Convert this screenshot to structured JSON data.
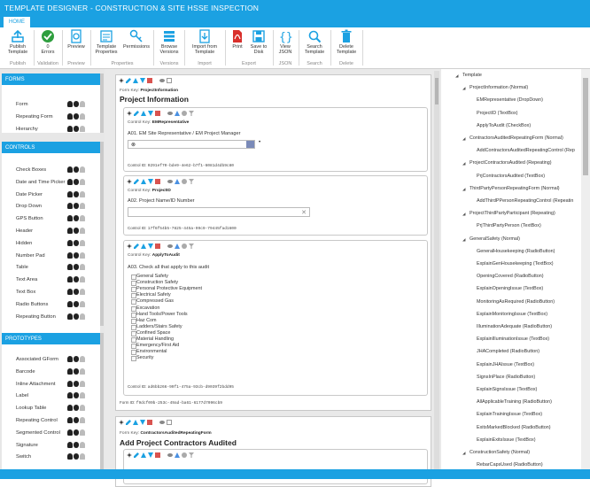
{
  "app": {
    "title": "TEMPLATE DESIGNER - CONSTRUCTION & SITE HSSE INSPECTION",
    "tab": "HOME"
  },
  "ribbon": {
    "buttons": [
      {
        "label": "Publish\nTemplate",
        "icon": "upload-icon"
      },
      {
        "label": "0\nErrors",
        "icon": "check-circle-icon"
      },
      {
        "label": "Preview",
        "icon": "preview-icon"
      },
      {
        "label": "Template\nProperties",
        "icon": "properties-icon"
      },
      {
        "label": "Permissions",
        "icon": "key-icon"
      },
      {
        "label": "Browse\nVersions",
        "icon": "versions-icon"
      },
      {
        "label": "Import from\nTemplate",
        "icon": "import-icon"
      },
      {
        "label": "Print",
        "icon": "pdf-icon"
      },
      {
        "label": "Save to\nDisk",
        "icon": "save-icon"
      },
      {
        "label": "View\nJSON",
        "icon": "json-icon"
      },
      {
        "label": "Search\nTemplate",
        "icon": "search-icon"
      },
      {
        "label": "Delete\nTemplate",
        "icon": "trash-icon"
      }
    ],
    "groups": [
      "Publish",
      "Validation",
      "Preview",
      "Properties",
      "Versions",
      "Import",
      "Export",
      "JSON",
      "Search",
      "Delete"
    ]
  },
  "left": {
    "forms": {
      "title": "FORMS",
      "items": [
        "Form",
        "Repeating Form",
        "Hierarchy"
      ]
    },
    "controls": {
      "title": "CONTROLS",
      "items": [
        "Check Boxes",
        "Date and Time Picker",
        "Date Picker",
        "Drop Down",
        "GPS Button",
        "Header",
        "Hidden",
        "Number Pad",
        "Table",
        "Text Area",
        "Text Box",
        "Radio Buttons",
        "Repeating Button"
      ]
    },
    "prototypes": {
      "title": "PROTOTYPES",
      "items": [
        "Associated GForm",
        "Barcode",
        "Inline Attachment",
        "Label",
        "Lookup Table",
        "Repeating Control",
        "Segmented Control",
        "Signature",
        "Switch"
      ]
    }
  },
  "canvas": {
    "form1": {
      "key_label": "Form Key:",
      "key": "ProjectInformation",
      "title": "Project Information",
      "id_label": "Form ID:",
      "id": "f9dcf09b-253c-49ad-ba61-6177d7096cb9"
    },
    "ctrl1": {
      "key_label": "Control Key:",
      "key": "EMRepresentative",
      "question": "A01. EM Site Representative / EM Project Manager",
      "id_label": "Control ID:",
      "id": "0291ef70-bde9-4e62-b7f1-6081d4db9c80"
    },
    "ctrl2": {
      "key_label": "Control Key:",
      "key": "ProjectID",
      "question": "A02. Project Name/ID Number",
      "id_label": "Control ID:",
      "id": "17f6f54b5-7825-445a-99c9-79445fad1600"
    },
    "ctrl3": {
      "key_label": "Control Key:",
      "key": "ApplyToAudit",
      "question": "A03. Check all that apply to this audit",
      "options": [
        "General Safety",
        "Construction Safety",
        "Personal Protective Equipment",
        "Electrical Safety",
        "Compressed Gas",
        "Excavation",
        "Hand Tools/Power Tools",
        "Haz Com",
        "Ladders/Stairs Safety",
        "Confined Space",
        "Material Handling",
        "Emergency/First Aid",
        "Environmental",
        "Security"
      ],
      "id_label": "Control ID:",
      "id": "ad6bb266-99f1-475a-93cb-d9039f2bdd95"
    },
    "form2": {
      "key_label": "Form Key:",
      "key": "ContractorsAuditedRepeatingForm",
      "title": "Add Project Contractors Audited"
    }
  },
  "tree": [
    {
      "label": "Template",
      "indent": 0,
      "arrow": "◢"
    },
    {
      "label": "ProjectInformation (Normal)",
      "indent": 1,
      "arrow": "◢"
    },
    {
      "label": "EMRepresentative (DropDown)",
      "indent": 2
    },
    {
      "label": "ProjectID (TextBox)",
      "indent": 2
    },
    {
      "label": "ApplyToAudit (CheckBox)",
      "indent": 2
    },
    {
      "label": "ContractorsAuditedRepeatingForm (Normal)",
      "indent": 1,
      "arrow": "◢"
    },
    {
      "label": "AddContractorsAuditedRepeatingControl (Rep",
      "indent": 2
    },
    {
      "label": "ProjectContractorsAudited (Repeating)",
      "indent": 1,
      "arrow": "◢"
    },
    {
      "label": "PrjContractorsAudited (TextBox)",
      "indent": 2
    },
    {
      "label": "ThirdPartyPersonRepeatingForm (Normal)",
      "indent": 1,
      "arrow": "◢"
    },
    {
      "label": "AddThirdPPersonRepeatingControl (Repeatin",
      "indent": 2
    },
    {
      "label": "ProjectThirdPartyParticipant (Repeating)",
      "indent": 1,
      "arrow": "◢"
    },
    {
      "label": "PrjThirdPartyPerson (TextBox)",
      "indent": 2
    },
    {
      "label": "GeneralSafety (Normal)",
      "indent": 1,
      "arrow": "◢"
    },
    {
      "label": "GeneralHousekeeping (RadioButton)",
      "indent": 2
    },
    {
      "label": "ExplainGenHousekeeping (TextBox)",
      "indent": 2
    },
    {
      "label": "OpeningCovered (RadioButton)",
      "indent": 2
    },
    {
      "label": "ExplainOpeningIssue (TextBox)",
      "indent": 2
    },
    {
      "label": "MonitoringAsRequired (RadioButton)",
      "indent": 2
    },
    {
      "label": "ExplainMonitoringIssue (TextBox)",
      "indent": 2
    },
    {
      "label": "IlluminationAdequate (RadioButton)",
      "indent": 2
    },
    {
      "label": "ExplainIlluminationIssue (TextBox)",
      "indent": 2
    },
    {
      "label": "JHACompleted (RadioButton)",
      "indent": 2
    },
    {
      "label": "ExplainJHAIssue (TextBox)",
      "indent": 2
    },
    {
      "label": "SignsInPlace (RadioButton)",
      "indent": 2
    },
    {
      "label": "ExplainSignsIssue (TextBox)",
      "indent": 2
    },
    {
      "label": "AllApplicableTraining (RadioButton)",
      "indent": 2
    },
    {
      "label": "ExplainTrainingIssue (TextBox)",
      "indent": 2
    },
    {
      "label": "ExitsMarkedBlocked (RadioButton)",
      "indent": 2
    },
    {
      "label": "ExplainExitsIssue (TextBox)",
      "indent": 2
    },
    {
      "label": "ConstructionSafety (Normal)",
      "indent": 1,
      "arrow": "◢"
    },
    {
      "label": "RebarCapsUsed (RadioButton)",
      "indent": 2
    }
  ],
  "colors": {
    "accent": "#1ba1e2",
    "delete": "#d9534f",
    "pdf": "#d9302c"
  }
}
